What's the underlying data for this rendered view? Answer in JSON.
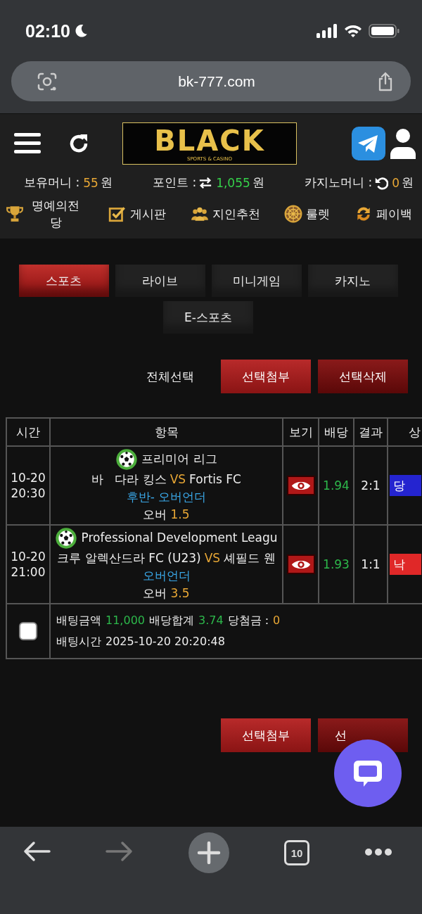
{
  "status_bar": {
    "time": "02:10"
  },
  "browser": {
    "url": "bk-777.com",
    "tab_count": "10"
  },
  "header": {
    "logo": "BLACK",
    "logo_subtitle": "SPORTS & CASINO"
  },
  "balances": [
    {
      "kind": "plain",
      "label": "보유머니 :",
      "value": "55",
      "unit": "원",
      "color": "#e8a735"
    },
    {
      "kind": "exchange",
      "label": "포인트 :",
      "value": "1,055",
      "unit": "원",
      "color": "#35d04a"
    },
    {
      "kind": "refresh",
      "label": "카지노머니 :",
      "value": "0",
      "unit": "원",
      "color": "#e8a735"
    }
  ],
  "nav": [
    {
      "kind": "trophy",
      "label": "명예의전당"
    },
    {
      "kind": "board",
      "label": "게시판"
    },
    {
      "kind": "people",
      "label": "지인추천"
    },
    {
      "kind": "wheel",
      "label": "룰렛"
    },
    {
      "kind": "cycle",
      "label": "페이백"
    }
  ],
  "categories": [
    {
      "label": "스포츠",
      "selected": true
    },
    {
      "label": "라이브",
      "selected": false
    },
    {
      "label": "미니게임",
      "selected": false
    },
    {
      "label": "카지노",
      "selected": false
    },
    {
      "label": "E-스포츠",
      "selected": false
    }
  ],
  "actions": {
    "select_all": "전체선택",
    "buttons": [
      {
        "label": "선택첨부",
        "kind": "attach"
      },
      {
        "label": "선택삭제",
        "kind": "delete"
      }
    ]
  },
  "table": {
    "columns": [
      "시간",
      "항목",
      "보기",
      "배당",
      "결과",
      "상"
    ],
    "rows": [
      {
        "date": "10-20",
        "time": "20:30",
        "league": "프리미어 리그",
        "home": "바   다라 킹스",
        "vs": "VS",
        "away": "Fortis FC",
        "market": "후반- 오버언더",
        "pick": "오버",
        "pick_value": "1.5",
        "odds": "1.94",
        "result": "2:1",
        "status": {
          "label": "당",
          "kind": "win"
        }
      },
      {
        "date": "10-20",
        "time": "21:00",
        "league": "Professional Development Leagu",
        "home": "크루 알렉산드라 FC (U23)",
        "vs": "VS",
        "away": "셰필드 웬",
        "market": "오버언더",
        "pick": "오버",
        "pick_value": "3.5",
        "odds": "1.93",
        "result": "1:1",
        "status": {
          "label": "낙",
          "kind": "lose"
        }
      }
    ],
    "summary": {
      "checked": false,
      "amount_label": "배팅금액",
      "amount": "11,000",
      "odds_label": "배당합계",
      "odds": "3.74",
      "payout_label": "당첨금 :",
      "payout": "0",
      "time_label": "배팅시간",
      "time": "2025-10-20 20:20:48"
    }
  },
  "bottom_buttons": [
    {
      "label": "선택첨부",
      "kind": "attach"
    },
    {
      "label": "선",
      "kind": "delete"
    }
  ]
}
